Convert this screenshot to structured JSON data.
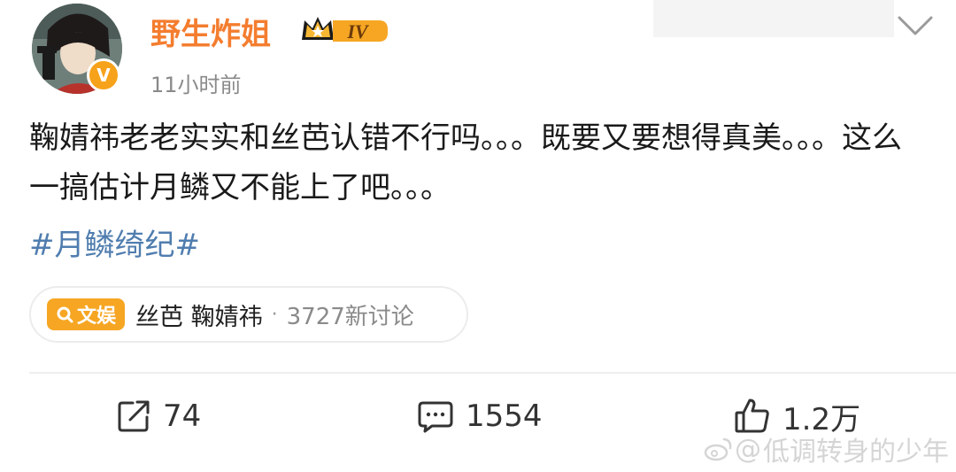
{
  "author": {
    "name": "野生炸姐",
    "verified_mark": "V",
    "level_badge": "IV",
    "badge_icon": "crown-icon"
  },
  "post": {
    "timestamp": "11小时前",
    "text": "鞠婧祎老老实实和丝芭认错不行吗。。。既要又要想得真美。。。这么一搞估计月鳞又不能上了吧。。。",
    "hashtag": "#月鳞绮纪#"
  },
  "topic": {
    "tag_label": "文娱",
    "tag_icon": "search-icon",
    "name": "丝芭 鞠婧祎",
    "separator": "·",
    "stat": "3727新讨论"
  },
  "actions": {
    "repost": {
      "icon": "repost-icon",
      "count": "74"
    },
    "comment": {
      "icon": "comment-icon",
      "count": "1554"
    },
    "like": {
      "icon": "like-icon",
      "count": "1.2万"
    }
  },
  "watermark": {
    "icon": "weibo-icon",
    "at": "@",
    "handle": "低调转身的少年"
  },
  "colors": {
    "username": "#f47d2f",
    "hashtag": "#507daf",
    "badge": "#f6a623",
    "verified": "#f7a21b"
  }
}
